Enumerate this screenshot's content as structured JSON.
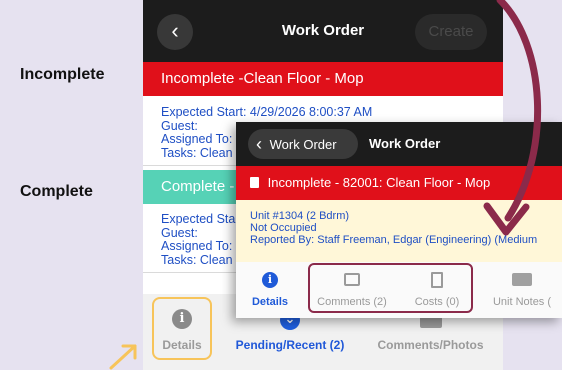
{
  "labels": {
    "incomplete": "Incomplete",
    "complete": "Complete"
  },
  "back_screen": {
    "title": "Work Order",
    "create_label": "Create",
    "incomplete_bar": "Incomplete -Clean Floor - Mop",
    "incomplete_lines": [
      "Expected Start: 4/29/2026 8:00:37 AM",
      "Guest:",
      "Assigned To:",
      "Tasks: Clean"
    ],
    "complete_bar": "Complete -",
    "complete_lines": [
      "Expected Sta",
      "Guest:",
      "Assigned To:",
      "Tasks: Clean"
    ],
    "tabs": [
      {
        "label": "Details",
        "icon": "info-icon"
      },
      {
        "label": "Pending/Recent (2)",
        "icon": "list-icon"
      },
      {
        "label": "Comments/Photos",
        "icon": "comments-photos-icon"
      }
    ]
  },
  "front_screen": {
    "back_label": "Work Order",
    "title": "Work Order",
    "status_bar": "Incomplete - 82001: Clean Floor - Mop",
    "info_lines": [
      "Unit #1304 (2 Bdrm)",
      "Not Occupied",
      "Reported By: Staff Freeman, Edgar (Engineering) (Medium"
    ],
    "tabs": [
      {
        "label": "Details",
        "icon": "info-icon"
      },
      {
        "label": "Comments (2)",
        "icon": "image-icon"
      },
      {
        "label": "Costs (0)",
        "icon": "receipt-icon"
      },
      {
        "label": "Unit Notes (",
        "icon": "book-icon"
      }
    ]
  },
  "colors": {
    "header": "#1c1c1c",
    "incomplete_red": "#e0101a",
    "complete_green": "#56d2b6",
    "link_blue": "#1f4fc4",
    "details_highlight": "#f7c45a",
    "tabs_highlight": "#8b2a4a"
  }
}
